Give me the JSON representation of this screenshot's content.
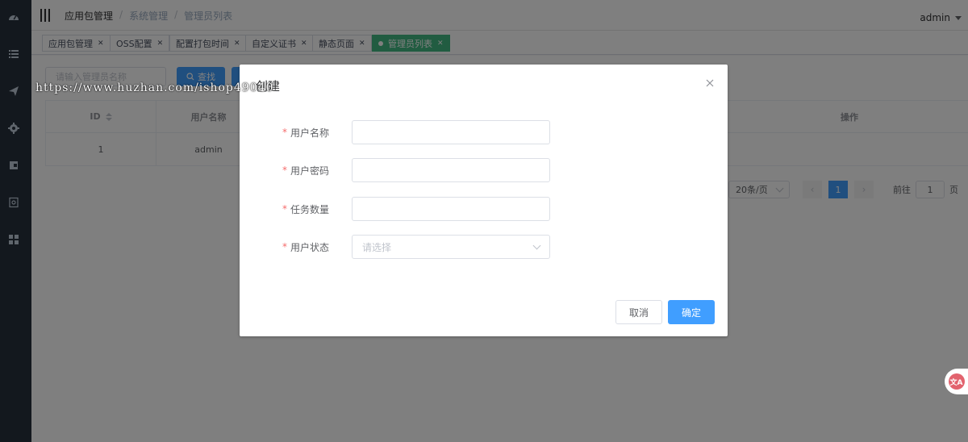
{
  "header": {
    "breadcrumb": [
      "应用包管理",
      "系统管理",
      "管理员列表"
    ],
    "user": "admin"
  },
  "tabs": [
    {
      "label": "应用包管理"
    },
    {
      "label": "OSS配置"
    },
    {
      "label": "配置打包时间"
    },
    {
      "label": "自定义证书"
    },
    {
      "label": "静态页面"
    },
    {
      "label": "管理员列表"
    }
  ],
  "search": {
    "placeholder": "请输入管理员名称",
    "button_label": "查找"
  },
  "table": {
    "columns": [
      "ID",
      "用户名称",
      "操作"
    ],
    "rows": [
      {
        "id": "1",
        "name": "admin"
      }
    ]
  },
  "pagination": {
    "page_size": "20条/页",
    "current_page": "1",
    "goto_prefix": "前往",
    "goto_value": "1",
    "goto_suffix": "页"
  },
  "watermark": "https://www.huzhan.com/ishop49040",
  "dialog": {
    "title": "创建",
    "fields": [
      {
        "label": "用户名称",
        "value": ""
      },
      {
        "label": "用户密码",
        "value": ""
      },
      {
        "label": "任务数量",
        "value": ""
      },
      {
        "label": "用户状态",
        "placeholder": "请选择"
      }
    ],
    "cancel_label": "取消",
    "ok_label": "确定"
  },
  "translate_widget": {
    "label": "文A"
  },
  "colors": {
    "sidebar": "#27313d",
    "primary": "#409eff",
    "tab_active": "#42b983",
    "required": "#f56c6c"
  }
}
